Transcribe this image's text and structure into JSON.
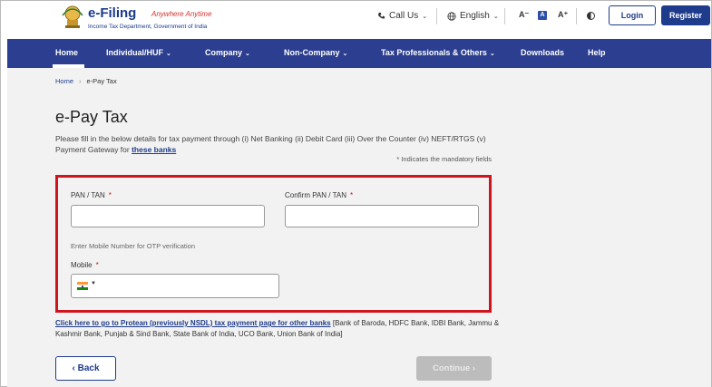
{
  "header": {
    "logo_title": "e-Filing",
    "logo_tagline": "Anywhere Anytime",
    "logo_subtitle": "Income Tax Department, Government of India",
    "call_us": "Call Us",
    "language": "English",
    "font_decrease": "A⁻",
    "font_normal": "A",
    "font_increase": "A⁺",
    "login": "Login",
    "register": "Register"
  },
  "nav": {
    "items": [
      {
        "label": "Home",
        "has_dropdown": false
      },
      {
        "label": "Individual/HUF",
        "has_dropdown": true
      },
      {
        "label": "Company",
        "has_dropdown": true
      },
      {
        "label": "Non-Company",
        "has_dropdown": true
      },
      {
        "label": "Tax Professionals & Others",
        "has_dropdown": true
      },
      {
        "label": "Downloads",
        "has_dropdown": false
      },
      {
        "label": "Help",
        "has_dropdown": false
      }
    ],
    "active": "Home"
  },
  "breadcrumb": {
    "home": "Home",
    "separator": "›",
    "current": "e-Pay Tax"
  },
  "page": {
    "title": "e-Pay Tax",
    "description": "Please fill in the below details for tax payment through (i) Net Banking (ii) Debit Card (iii) Over the Counter (iv) NEFT/RTGS (v) Payment Gateway for ",
    "description_link": "these banks",
    "mandatory_note": "* Indicates the mandatory fields"
  },
  "form": {
    "pan_label": "PAN / TAN",
    "pan_value": "",
    "confirm_pan_label": "Confirm PAN / TAN",
    "confirm_pan_value": "",
    "required_mark": "*",
    "otp_hint": "Enter Mobile Number for OTP verification",
    "mobile_label": "Mobile",
    "mobile_value": "",
    "country_caret": "▼"
  },
  "protean": {
    "link": "Click here to go to Protean (previously NSDL) tax payment page for other banks",
    "banks": " [Bank of Baroda, HDFC Bank, IDBI Bank, Jammu & Kashmir Bank, Punjab & Sind Bank, State Bank of India, UCO Bank, Union Bank of India]"
  },
  "actions": {
    "back": "‹  Back",
    "continue": "Continue  ›"
  },
  "colors": {
    "brand_blue": "#2c3e8f",
    "highlight_red": "#d0141e",
    "disabled_gray": "#bcbcbc"
  }
}
